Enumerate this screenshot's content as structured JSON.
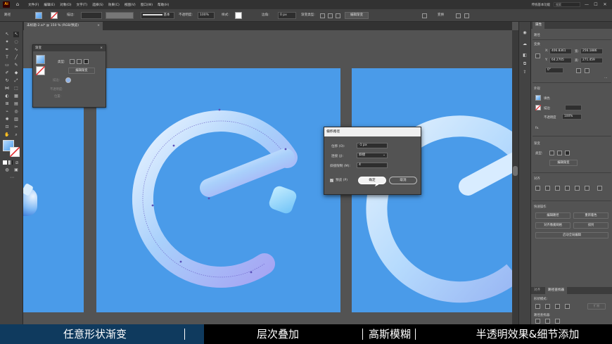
{
  "menubar": {
    "app_logo": "Ai",
    "items": [
      "文件(F)",
      "编辑(E)",
      "对象(O)",
      "文字(T)",
      "选择(S)",
      "效果(C)",
      "视图(V)",
      "窗口(W)",
      "帮助(H)"
    ],
    "search_placeholder": "搜索",
    "workspace": "传统基本功能",
    "min": "—",
    "max": "☐",
    "close": "✕"
  },
  "controlbar": {
    "selection_label": "路径",
    "stroke_label": "描边:",
    "brush_label": "基本",
    "opacity_label": "不透明度:",
    "opacity_value": "100%",
    "style_label": "样式:",
    "corner_label": "边角:",
    "corner_value": "0 px",
    "edit_gradient_type_label": "渐变类型:",
    "edit_gradient_button": "编辑渐变",
    "transform_label": "变换"
  },
  "document": {
    "tab_title": "未标题-2.ai* @ 150 % (RGB/预览)",
    "tab_close": "×"
  },
  "gradient_panel": {
    "title": "渐变",
    "close": "×",
    "type_label": "类型:",
    "edit_button": "编辑渐变",
    "stroke_label": "描边:",
    "opacity_label": "不透明度:",
    "location_label": "位置:"
  },
  "offset_dialog": {
    "title": "偏移路径",
    "offset_label": "位移 (O):",
    "offset_value": "-1 px",
    "joins_label": "连接 (J):",
    "joins_value": "斜接",
    "miter_label": "斜接限制 (M):",
    "miter_value": "4",
    "preview_label": "预览 (P)",
    "ok_button": "确定",
    "cancel_button": "取消"
  },
  "right_panel": {
    "tabs": [
      "属性"
    ],
    "selection_type": "路径",
    "transform_section": "变换",
    "x_label": "X:",
    "x_value": "406.8361",
    "y_label": "Y:",
    "y_value": "64.2705",
    "w_label": "宽:",
    "w_value": "256.1886",
    "h_label": "高:",
    "h_value": "271.459",
    "angle_value": "0°",
    "appearance_section": "外观",
    "fill_label": "填色",
    "stroke_label": "描边",
    "opacity_label": "不透明度",
    "opacity_value": "100%",
    "fx_label": "fx.",
    "gradient_section": "渐变",
    "gradient_type_label": "类型:",
    "edit_gradient_button": "编辑渐变",
    "align_section": "对齐",
    "quick_actions_section": "快速操作",
    "qa_buttons": [
      "编辑路径",
      "重新着色",
      "对齐像素网格",
      "排列",
      "启动全局编辑"
    ],
    "bottom_tabs": [
      "对齐",
      "路径查找器"
    ],
    "shape_mode_label": "形状模式:",
    "pathfinder_label": "路径查找器:",
    "expand_button": "扩展"
  },
  "caption": {
    "items": [
      "任意形状渐变",
      "层次叠加",
      "高斯模糊",
      "半透明效果&细节添加"
    ]
  },
  "colors": {
    "artboard": "#4a9be9",
    "ui_dark": "#323232",
    "ui_mid": "#535353",
    "caption_bg": "#000000"
  }
}
